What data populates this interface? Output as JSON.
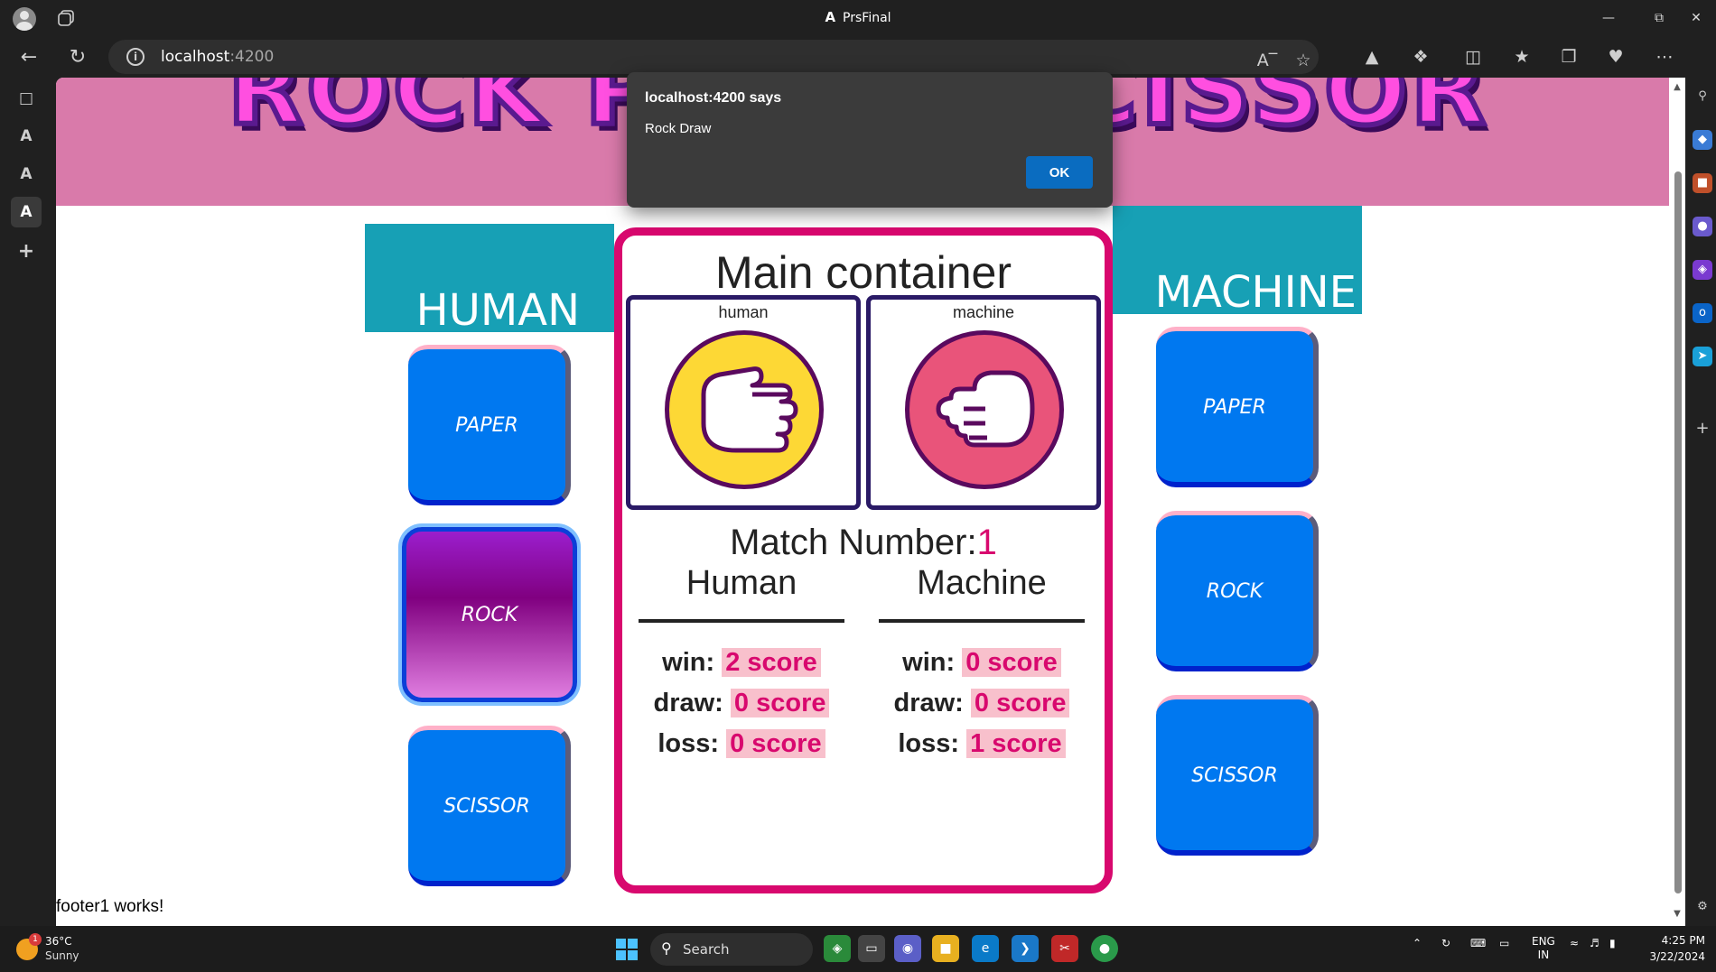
{
  "browser": {
    "window_title": "PrsFinal",
    "url_host": "localhost",
    "url_port": ":4200"
  },
  "page": {
    "banner_title": "ROCK PAPER SCISSOR",
    "human_header": "HUMAN",
    "machine_header": "MACHINE",
    "human_buttons": [
      "PAPER",
      "ROCK",
      "SCISSOR"
    ],
    "human_selected": "ROCK",
    "machine_buttons": [
      "PAPER",
      "ROCK",
      "SCISSOR"
    ],
    "main": {
      "title": "Main container",
      "human_caption": "human",
      "machine_caption": "machine",
      "human_choice": "paper",
      "machine_choice": "rock",
      "match_label": "Match Number:",
      "match_number": "1",
      "human_col": {
        "title": "Human",
        "win_label": "win:",
        "win_value": "2 score",
        "draw_label": "draw:",
        "draw_value": "0 score",
        "loss_label": "loss:",
        "loss_value": "0 score"
      },
      "machine_col": {
        "title": "Machine",
        "win_label": "win:",
        "win_value": "0 score",
        "draw_label": "draw:",
        "draw_value": "0 score",
        "loss_label": "loss:",
        "loss_value": "1 score"
      }
    },
    "footer": "footer1 works!"
  },
  "dialog": {
    "title": "localhost:4200 says",
    "message": "Rock Draw",
    "ok_label": "OK"
  },
  "taskbar": {
    "weather_temp": "36°C",
    "weather_cond": "Sunny",
    "weather_badge": "1",
    "search_label": "Search",
    "lang_top": "ENG",
    "lang_bottom": "IN",
    "time": "4:25 PM",
    "date": "3/22/2024"
  },
  "colors": {
    "accent_pink": "#d8086e",
    "button_blue": "#0078f0",
    "header_teal": "#17a0b5",
    "banner_pink": "#d97aaa"
  }
}
